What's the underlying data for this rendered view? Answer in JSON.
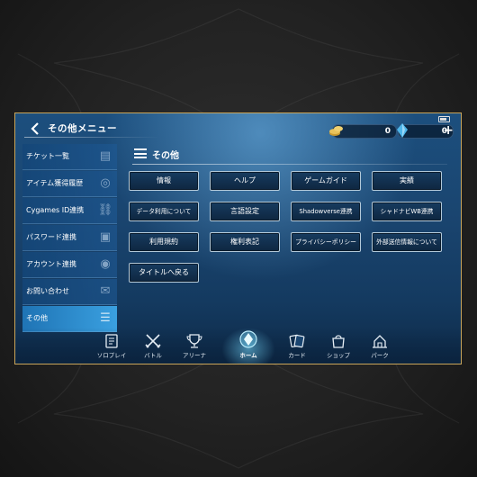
{
  "header": {
    "title": "その他メニュー",
    "currency_gold": "0",
    "currency_crystal": "0",
    "plus": "+"
  },
  "sidebar": {
    "items": [
      {
        "label": "チケット一覧",
        "icon": "ticket-icon"
      },
      {
        "label": "アイテム獲得履歴",
        "icon": "items-icon"
      },
      {
        "label": "Cygames ID連携",
        "icon": "link-icon"
      },
      {
        "label": "パスワード連携",
        "icon": "password-icon"
      },
      {
        "label": "アカウント連携",
        "icon": "account-icon"
      },
      {
        "label": "お問い合わせ",
        "icon": "mail-icon"
      },
      {
        "label": "その他",
        "icon": "menu-icon"
      }
    ],
    "active_index": 6
  },
  "section": {
    "title": "その他"
  },
  "buttons": {
    "row1": [
      "情報",
      "ヘルプ",
      "ゲームガイド",
      "実績"
    ],
    "row2": [
      "データ利用について",
      "言語設定",
      "Shadowverse連携",
      "シャドナビWB連携"
    ],
    "row3": [
      "利用規約",
      "権利表記",
      "プライバシーポリシー",
      "外部送信情報について"
    ],
    "row4": [
      "タイトルへ戻る"
    ]
  },
  "nav": {
    "items": [
      {
        "label": "ソロプレイ",
        "icon": "solo-play-icon"
      },
      {
        "label": "バトル",
        "icon": "battle-swords-icon"
      },
      {
        "label": "アリーナ",
        "icon": "arena-trophy-icon"
      },
      {
        "label": "ホーム",
        "icon": "home-crystal-icon"
      },
      {
        "label": "カード",
        "icon": "cards-icon"
      },
      {
        "label": "ショップ",
        "icon": "shop-bag-icon"
      },
      {
        "label": "パーク",
        "icon": "park-icon"
      }
    ],
    "active_index": 3
  },
  "colors": {
    "frame_border": "#c9a55a",
    "panel_blue": "#1a4570",
    "active_tab": "#3aa0e0",
    "button_border": "#b3c9d9"
  }
}
